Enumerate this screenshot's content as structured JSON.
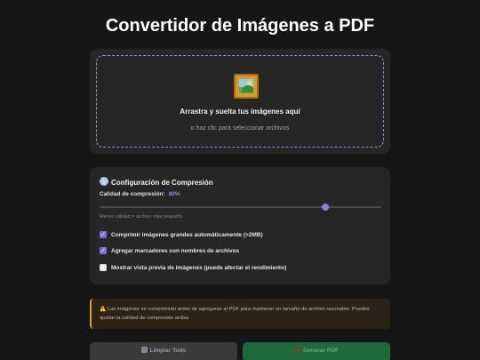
{
  "page": {
    "title": "Convertidor de Imágenes a PDF"
  },
  "upload": {
    "icon": "framed-picture-icon",
    "title": "Arrastra y suelta tus imágenes aquí",
    "subtitle": "o haz clic para seleccionar archivos"
  },
  "compression": {
    "icon": "gear-icon",
    "title": "Configuración de Compresión",
    "quality_label": "Calidad de compresión:",
    "quality_value": "80%",
    "quality_fraction": 0.8,
    "quality_hint": "Menor calidad = archivo más pequeño",
    "options": [
      {
        "label": "Comprimir imágenes grandes automáticamente (>2MB)",
        "checked": true
      },
      {
        "label": "Agregar marcadores con nombres de archivos",
        "checked": true
      },
      {
        "label": "Mostrar vista previa de imágenes (puede afectar el rendimiento)",
        "checked": false
      }
    ]
  },
  "notice": {
    "icon": "warning-icon",
    "text": "Las imágenes se comprimirán antes de agregarse al PDF para mantener un tamaño de archivo razonable. Puedes ajustar la calidad de compresión arriba."
  },
  "actions": {
    "clear_icon": "trash-icon",
    "clear_label": "Limpiar Todo",
    "generate_icon": "pdf-icon",
    "generate_label": "Generar PDF"
  },
  "colors": {
    "background": "#161616",
    "panel": "#262626",
    "accent": "#8e7ed0",
    "warning": "#d9a23a",
    "generate": "#1d6a3a"
  }
}
